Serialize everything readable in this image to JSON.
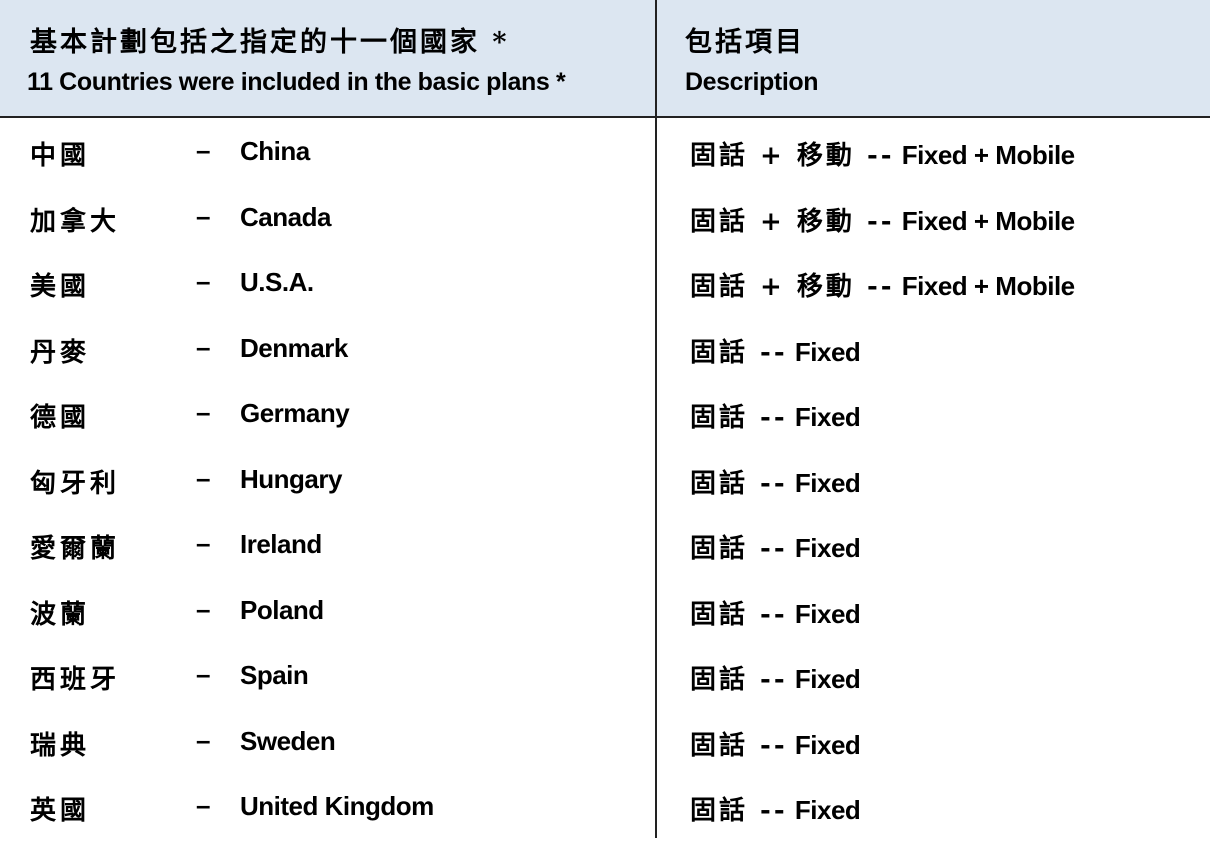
{
  "header": {
    "col1_zh": "基本計劃包括之指定的十一個國家 *",
    "col1_en": "11 Countries were included in the basic plans *",
    "col2_zh": "包括項目",
    "col2_en": "Description"
  },
  "separator": "–",
  "rows": [
    {
      "zh": "中國",
      "en": "China",
      "desc_zh": "固話 + 移動 --",
      "desc_en": "Fixed + Mobile"
    },
    {
      "zh": "加拿大",
      "en": "Canada",
      "desc_zh": "固話 + 移動 --",
      "desc_en": "Fixed + Mobile"
    },
    {
      "zh": "美國",
      "en": "U.S.A.",
      "desc_zh": "固話 + 移動 --",
      "desc_en": "Fixed + Mobile"
    },
    {
      "zh": "丹麥",
      "en": "Denmark",
      "desc_zh": "固話 --",
      "desc_en": "Fixed"
    },
    {
      "zh": "德國",
      "en": "Germany",
      "desc_zh": "固話 --",
      "desc_en": "Fixed"
    },
    {
      "zh": "匈牙利",
      "en": "Hungary",
      "desc_zh": "固話 --",
      "desc_en": "Fixed"
    },
    {
      "zh": "愛爾蘭",
      "en": "Ireland",
      "desc_zh": "固話 --",
      "desc_en": "Fixed"
    },
    {
      "zh": "波蘭",
      "en": "Poland",
      "desc_zh": "固話 --",
      "desc_en": "Fixed"
    },
    {
      "zh": "西班牙",
      "en": "Spain",
      "desc_zh": "固話 --",
      "desc_en": "Fixed"
    },
    {
      "zh": "瑞典",
      "en": "Sweden",
      "desc_zh": "固話 --",
      "desc_en": "Fixed"
    },
    {
      "zh": "英國",
      "en": "United Kingdom",
      "desc_zh": "固話 --",
      "desc_en": "Fixed"
    }
  ]
}
